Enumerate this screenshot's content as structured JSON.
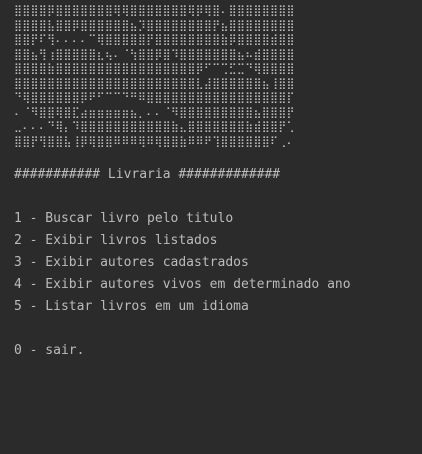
{
  "ascii_art": [
    "⣿⣿⣿⣿⡿⣿⣿⣿⣿⣿⣿⣿⢿⢿⣿⣿⣿⣿⣿⣿⣿⢿⡿⢿⣿⠄⣿⣿⣿⣿⣿⣿⣿⣿",
    "⣿⣿⣿⣿⣧⣿⣿⡿⣿⣿⣿⣿⣿⣿⣦⡹⣿⣿⣿⣿⣿⣿⣿⣿⡟⣦⣿⣿⣿⣿⣿⣿⣿⣿",
    "⣿⣿⡟⠏⢻⠄⠄⠄⠄⠉⢿⣿⣿⣿⣿⣿⡟⣿⣿⣿⣿⣿⣿⣿⣿⣷⡿⣿⣿⣿⣿⣾⣿⣿",
    "⣿⣿⣦⢻⢰⣿⣿⣿⣿⣿⣆⢦⠄⠈⢳⣿⣿⡿⣿⠹⣿⣿⣿⣿⣿⣿⣿⣦⠦⣾⣿⣿⣿⣿",
    "⣿⣿⣿⣿⣷⣿⣿⣿⣿⣿⣿⣿⣿⣿⣿⣿⣿⣿⣿⣿⣿⣿⡿⠋⠉⢉⣋⣉⠙⢿⣿⣿⣿⣿",
    "⣿⣿⣿⣿⣿⣿⣿⣿⣿⣿⣿⣿⣿⣿⣿⣿⣿⣿⣿⣿⣿⣿⣇⣼⣿⣿⣿⣿⣿⣿⣦⢸⣿⣿",
    "⠙⢿⣿⣿⣿⣿⣿⣿⡿⠟⠋⠉⠉⠙⠛⠿⣿⣿⣿⣿⣿⣿⣿⣿⣿⣿⣿⣿⣿⣿⣿⣿⣿⡏",
    "⠄⠈⠻⣿⣿⢿⣿⣏⣴⣶⣶⣶⣶⣶⣦⡀⠄⠄⠈⠻⣿⣿⣿⣿⣿⣿⣿⣿⣿⣦⣿⣿⣿⡟",
    "⣀⠄⠄⠄⠙⢿⡄⠹⣿⣿⣿⣿⣿⣿⣿⣿⣿⣿⣿⣷⣄⣿⣿⣿⣿⣿⣿⣿⣷⣾⣿⣿⡟⢁",
    "⣿⣿⡟⢻⣿⣿⣧⢸⡿⢿⣿⣿⠿⠿⠿⢿⠿⢿⣿⣿⣷⠿⠿⠟⢹⣿⣿⣿⣿⣿⣿⠏⢀⠄"
  ],
  "console": {
    "header": "########### Livraria #############",
    "options": [
      "1 - Buscar livro pelo titulo",
      "2 - Exibir livros listados",
      "3 - Exibir autores cadastrados",
      "4 - Exibir autores vivos em determinado ano",
      "5 - Listar livros em um idioma"
    ],
    "exit": "0 - sair."
  }
}
